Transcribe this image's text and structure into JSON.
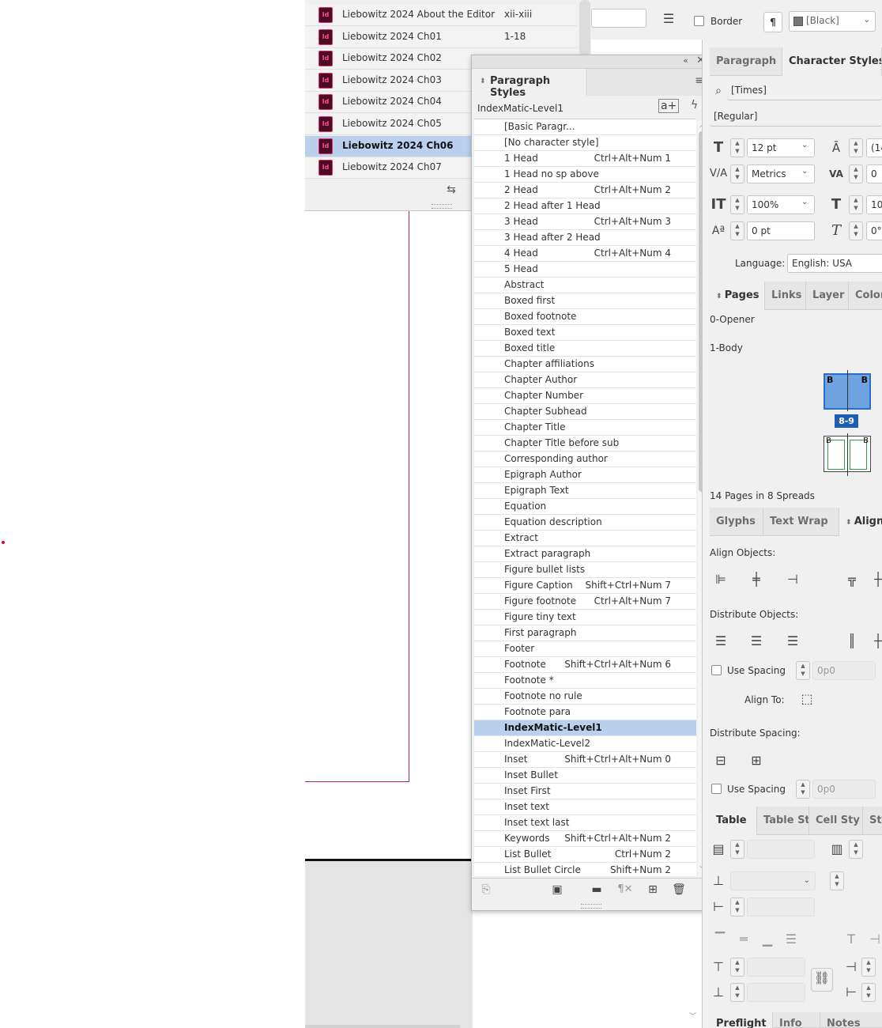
{
  "book_panel": {
    "items": [
      {
        "name": "Liebowitz 2024 About the Editor",
        "pages": "xii-xiii"
      },
      {
        "name": "Liebowitz 2024 Ch01",
        "pages": "1-18"
      },
      {
        "name": "Liebowitz 2024 Ch02",
        "pages": ""
      },
      {
        "name": "Liebowitz 2024 Ch03",
        "pages": ""
      },
      {
        "name": "Liebowitz 2024 Ch04",
        "pages": ""
      },
      {
        "name": "Liebowitz 2024 Ch05",
        "pages": ""
      },
      {
        "name": "Liebowitz 2024 Ch06",
        "pages": "",
        "selected": true
      },
      {
        "name": "Liebowitz 2024 Ch07",
        "pages": ""
      }
    ]
  },
  "table_strip": {
    "border_label": "Border",
    "stroke_color": "[Black]"
  },
  "paragraph_styles": {
    "title": "Paragraph Styles",
    "current_style": "IndexMatic-Level1",
    "styles": [
      {
        "name": "[Basic Paragr...",
        "shortcut": ""
      },
      {
        "name": "[No character style]",
        "shortcut": ""
      },
      {
        "name": "1 Head",
        "shortcut": "Ctrl+Alt+Num 1"
      },
      {
        "name": "1 Head no sp above",
        "shortcut": ""
      },
      {
        "name": "2 Head",
        "shortcut": "Ctrl+Alt+Num 2"
      },
      {
        "name": "2 Head after 1 Head",
        "shortcut": ""
      },
      {
        "name": "3 Head",
        "shortcut": "Ctrl+Alt+Num 3"
      },
      {
        "name": "3 Head after 2 Head",
        "shortcut": ""
      },
      {
        "name": "4 Head",
        "shortcut": "Ctrl+Alt+Num 4"
      },
      {
        "name": "5 Head",
        "shortcut": ""
      },
      {
        "name": "Abstract",
        "shortcut": ""
      },
      {
        "name": "Boxed first",
        "shortcut": ""
      },
      {
        "name": "Boxed footnote",
        "shortcut": ""
      },
      {
        "name": "Boxed text",
        "shortcut": ""
      },
      {
        "name": "Boxed title",
        "shortcut": ""
      },
      {
        "name": "Chapter affiliations",
        "shortcut": ""
      },
      {
        "name": "Chapter Author",
        "shortcut": ""
      },
      {
        "name": "Chapter Number",
        "shortcut": ""
      },
      {
        "name": "Chapter Subhead",
        "shortcut": ""
      },
      {
        "name": "Chapter Title",
        "shortcut": ""
      },
      {
        "name": "Chapter Title before sub",
        "shortcut": ""
      },
      {
        "name": "Corresponding author",
        "shortcut": ""
      },
      {
        "name": "Epigraph Author",
        "shortcut": ""
      },
      {
        "name": "Epigraph Text",
        "shortcut": ""
      },
      {
        "name": "Equation",
        "shortcut": ""
      },
      {
        "name": "Equation description",
        "shortcut": ""
      },
      {
        "name": "Extract",
        "shortcut": ""
      },
      {
        "name": "Extract paragraph",
        "shortcut": ""
      },
      {
        "name": "Figure bullet lists",
        "shortcut": ""
      },
      {
        "name": "Figure Caption",
        "shortcut": "Shift+Ctrl+Num 7"
      },
      {
        "name": "Figure footnote",
        "shortcut": "Ctrl+Alt+Num 7"
      },
      {
        "name": "Figure tiny text",
        "shortcut": ""
      },
      {
        "name": "First paragraph",
        "shortcut": ""
      },
      {
        "name": "Footer",
        "shortcut": ""
      },
      {
        "name": "Footnote",
        "shortcut": "Shift+Ctrl+Alt+Num 6"
      },
      {
        "name": "Footnote *",
        "shortcut": ""
      },
      {
        "name": "Footnote no rule",
        "shortcut": ""
      },
      {
        "name": "Footnote para",
        "shortcut": ""
      },
      {
        "name": "IndexMatic-Level1",
        "shortcut": "",
        "selected": true
      },
      {
        "name": "IndexMatic-Level2",
        "shortcut": ""
      },
      {
        "name": "Inset",
        "shortcut": "Shift+Ctrl+Alt+Num 0"
      },
      {
        "name": "Inset Bullet",
        "shortcut": ""
      },
      {
        "name": "Inset First",
        "shortcut": ""
      },
      {
        "name": "Inset text",
        "shortcut": ""
      },
      {
        "name": "Inset text last",
        "shortcut": ""
      },
      {
        "name": "Keywords",
        "shortcut": "Shift+Ctrl+Alt+Num 2"
      },
      {
        "name": "List Bullet",
        "shortcut": "Ctrl+Num 2"
      },
      {
        "name": "List Bullet Circle",
        "shortcut": "Shift+Num 2"
      }
    ]
  },
  "character_panel": {
    "tabs": [
      "Paragraph",
      "Character Styles"
    ],
    "font_family": "[Times]",
    "font_style": "[Regular]",
    "font_size": "12 pt",
    "leading": "(14",
    "kerning": "Metrics",
    "tracking": "0",
    "vertical_scale": "100%",
    "horizontal_scale": "10",
    "baseline_shift": "0 pt",
    "skew": "0°",
    "language_label": "Language:",
    "language": "English: USA"
  },
  "pages_panel": {
    "tabs": [
      "Pages",
      "Links",
      "Layer",
      "Color"
    ],
    "masters": [
      "0-Opener",
      "1-Body"
    ],
    "spread_label": "8-9",
    "master_letter": "B",
    "summary": "14 Pages in 8 Spreads"
  },
  "align_panel": {
    "tabs": [
      "Glyphs",
      "Text Wrap",
      "Align"
    ],
    "align_objects": "Align Objects:",
    "distribute_objects": "Distribute Objects:",
    "use_spacing": "Use Spacing",
    "spacing_value": "0p0",
    "align_to": "Align To:",
    "distribute_spacing": "Distribute Spacing:"
  },
  "table_panel": {
    "tabs": [
      "Table",
      "Table St",
      "Cell Sty",
      "St"
    ]
  },
  "bottom_tabs": [
    "Preflight",
    "Info",
    "Notes"
  ]
}
